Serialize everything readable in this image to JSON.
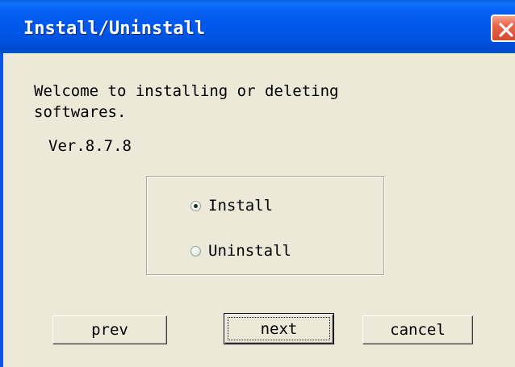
{
  "window": {
    "title": "Install/Uninstall",
    "close_icon": "close-icon"
  },
  "content": {
    "welcome_text": "Welcome to installing or deleting\nsoftwares.",
    "version": "Ver.8.7.8"
  },
  "options": {
    "install_label": "Install",
    "install_selected": true,
    "uninstall_label": "Uninstall",
    "uninstall_selected": false
  },
  "buttons": {
    "prev_label": "prev",
    "next_label": "next",
    "cancel_label": "cancel"
  },
  "colors": {
    "title_bar": "#0058ee",
    "close_button": "#e8654a",
    "dialog_background": "#ece9d8"
  }
}
